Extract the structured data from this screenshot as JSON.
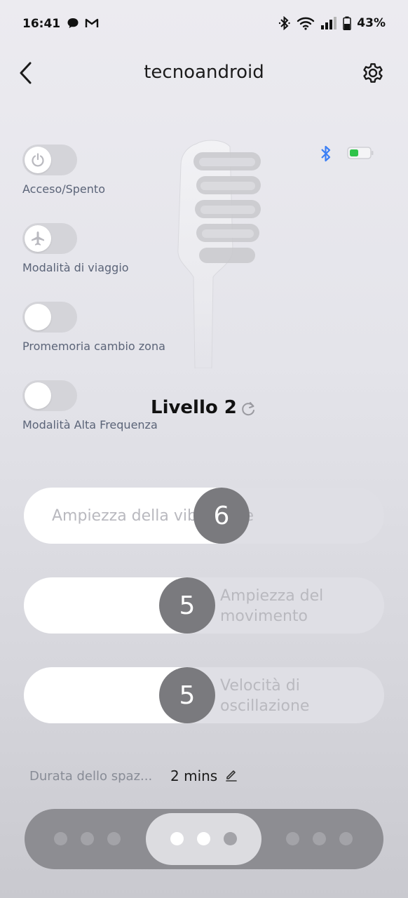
{
  "status_bar": {
    "time": "16:41",
    "battery_percent": "43%",
    "left_icons": [
      "chat-bubble-icon",
      "gmail-icon"
    ],
    "right_icons": [
      "bluetooth-icon",
      "wifi-icon",
      "signal-icon",
      "battery-icon"
    ]
  },
  "header": {
    "title": "tecnoandroid",
    "back_icon": "chevron-left-icon",
    "settings_icon": "gear-icon"
  },
  "toggles": [
    {
      "label": "Acceso/Spento",
      "icon": "power-icon",
      "on": false
    },
    {
      "label": "Modalità di viaggio",
      "icon": "airplane-icon",
      "on": false
    },
    {
      "label": "Promemoria cambio zona",
      "icon": "",
      "on": false
    },
    {
      "label": "Modalità Alta Frequenza",
      "icon": "",
      "on": false
    }
  ],
  "device": {
    "bluetooth_color": "#3b7ff5",
    "battery_color": "#2fc34a"
  },
  "level": {
    "label": "Livello 2"
  },
  "sliders": [
    {
      "label": "Ampiezza della vibrazione",
      "value": "6"
    },
    {
      "label": "Ampiezza del movimento",
      "value": "5"
    },
    {
      "label": "Velocità di oscillazione",
      "value": "5"
    }
  ],
  "interval": {
    "label": "Durata dello spaz...",
    "value": "2 mins"
  },
  "carousel": {
    "pages": 3,
    "selected_page": 2
  }
}
